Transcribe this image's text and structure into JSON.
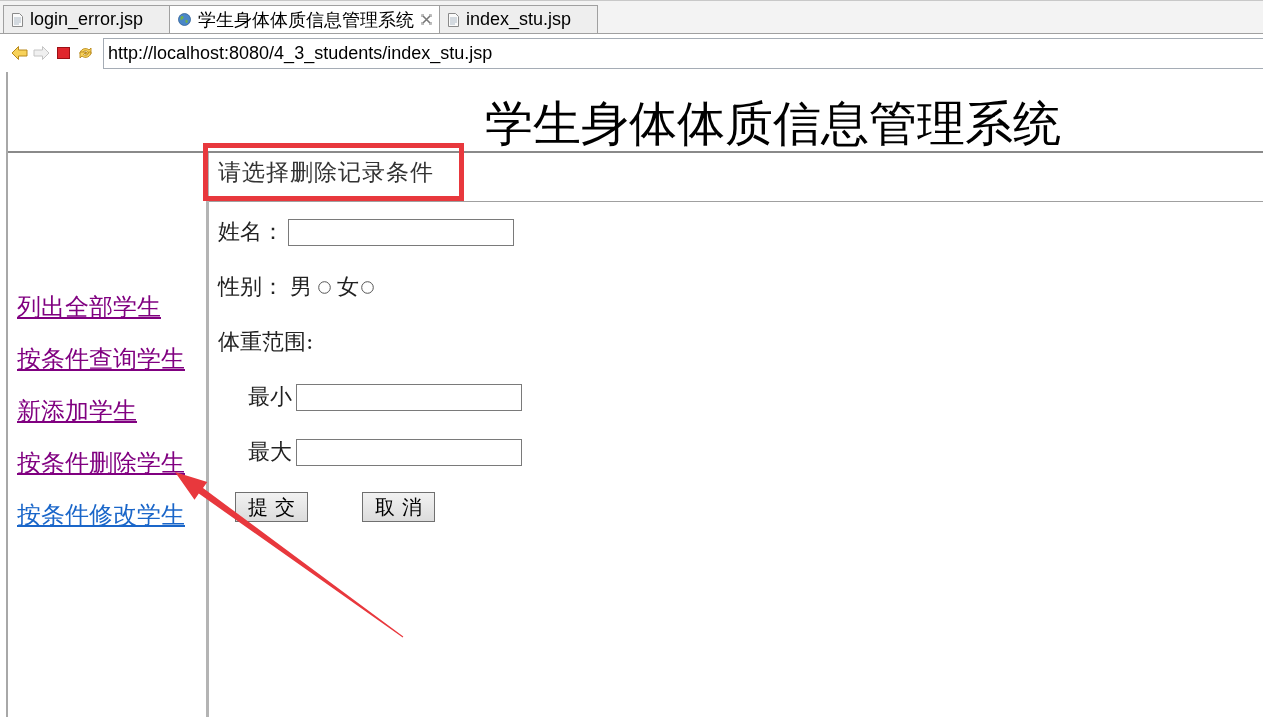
{
  "browser": {
    "tabs": [
      {
        "label": "login_error.jsp",
        "kind": "file",
        "selected": false
      },
      {
        "label": "学生身体体质信息管理系统",
        "kind": "web",
        "selected": true
      },
      {
        "label": "index_stu.jsp",
        "kind": "file",
        "selected": false
      }
    ],
    "toolbar": [
      {
        "kind": "back",
        "disabled": false
      },
      {
        "kind": "forward",
        "disabled": true
      },
      {
        "kind": "stop",
        "disabled": false
      },
      {
        "kind": "refresh",
        "disabled": false
      }
    ],
    "address": {
      "value": "http://localhost:8080/4_3_students/index_stu.jsp"
    }
  },
  "page": {
    "title": "学生身体体质信息管理系统",
    "nav_links": [
      {
        "label": "列出全部学生",
        "visited": true
      },
      {
        "label": "按条件查询学生",
        "visited": true
      },
      {
        "label": "新添加学生",
        "visited": true
      },
      {
        "label": "按条件删除学生",
        "visited": true
      },
      {
        "label": "按条件修改学生",
        "visited": false
      }
    ],
    "heading": "请选择删除记录条件",
    "form": {
      "name_label": "姓名：",
      "gender_label": "性别：",
      "gender_options": [
        {
          "label": "男",
          "selected": false
        },
        {
          "label": "女",
          "selected": false
        }
      ],
      "weight_label": "体重范围:",
      "weight_min_label": "最小",
      "weight_max_label": "最大",
      "buttons": [
        "提 交",
        "取 消"
      ]
    }
  }
}
